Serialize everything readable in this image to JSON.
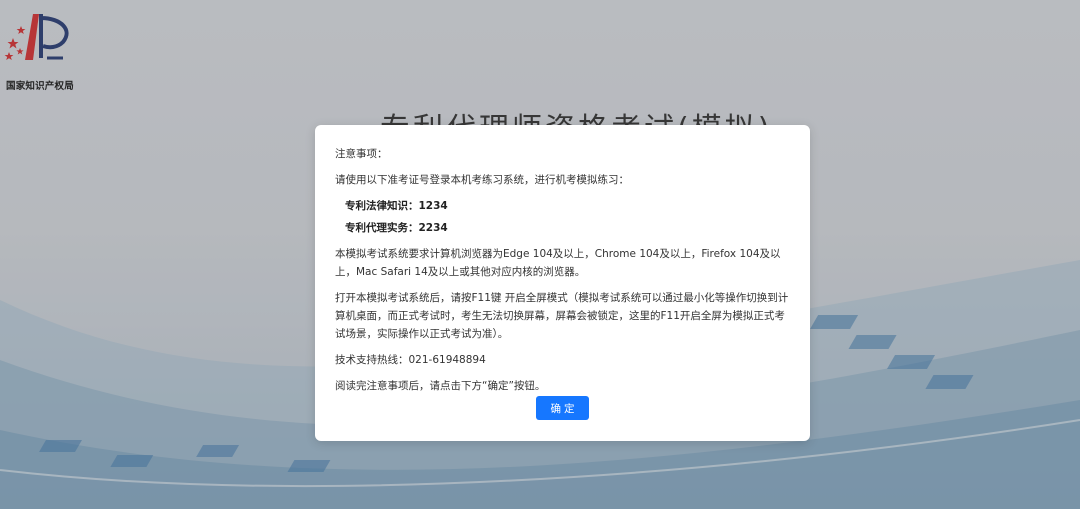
{
  "header": {
    "logo_name": "国家知识产权局",
    "page_title": "专利代理师资格考试(模拟)"
  },
  "notice": {
    "heading": "注意事项：",
    "intro": "请使用以下准考证号登录本机考练习系统，进行机考模拟练习：",
    "codes": [
      {
        "label": "专利法律知识：1234"
      },
      {
        "label": "专利代理实务：2234"
      }
    ],
    "browser_req": "本模拟考试系统要求计算机浏览器为Edge 104及以上，Chrome 104及以上，Firefox 104及以上，Mac Safari 14及以上或其他对应内核的浏览器。",
    "fullscreen": "打开本模拟考试系统后，请按F11键 开启全屏模式（模拟考试系统可以通过最小化等操作切换到计算机桌面，而正式考试时，考生无法切换屏幕，屏幕会被锁定，这里的F11开启全屏为模拟正式考试场景，实际操作以正式考试为准）。",
    "hotline": "技术支持热线：021-61948894",
    "closing": "阅读完注意事项后，请点击下方“确定”按钮。",
    "confirm_label": "确定"
  },
  "colors": {
    "primary_button": "#1677ff",
    "logo_red": "#d6282b",
    "logo_navy": "#1f3470"
  }
}
